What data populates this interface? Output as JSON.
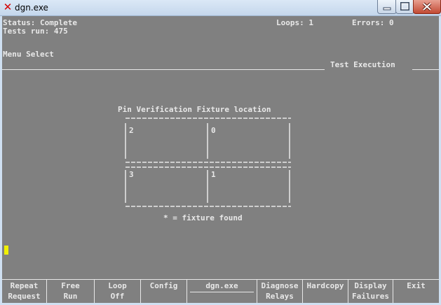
{
  "window": {
    "title": "dgn.exe"
  },
  "status": {
    "status_line": "Status: Complete",
    "tests_run": "Tests run: 475",
    "loops": "Loops: 1",
    "errors": "Errors: 0"
  },
  "menu": {
    "heading": "Menu Select",
    "section": "Test Execution"
  },
  "fixture": {
    "title": "Pin Verification Fixture location",
    "cells": [
      "2",
      "0",
      "3",
      "1"
    ],
    "legend": "* = fixture found"
  },
  "function_keys": [
    {
      "line1": "Repeat",
      "line2": "Request"
    },
    {
      "line1": "Free",
      "line2": "Run"
    },
    {
      "line1": "Loop",
      "line2": "Off"
    },
    {
      "line1": "Config",
      "line2": ""
    },
    {
      "line1": "dgn.exe",
      "line2": ""
    },
    {
      "line1": "Diagnose",
      "line2": "Relays"
    },
    {
      "line1": "Hardcopy",
      "line2": ""
    },
    {
      "line1": "Display",
      "line2": "Failures"
    },
    {
      "line1": "Exit",
      "line2": ""
    }
  ]
}
